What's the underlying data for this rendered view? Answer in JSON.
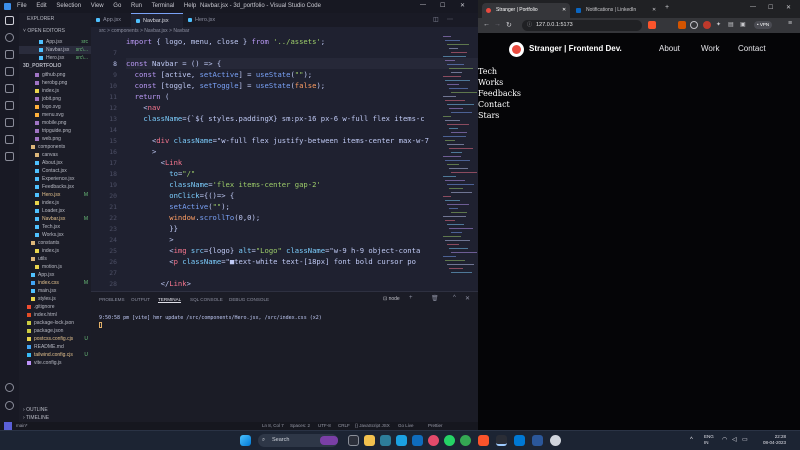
{
  "vscode": {
    "title": "Navbar.jsx - 3d_portfolio - Visual Studio Code",
    "menu": [
      "File",
      "Edit",
      "Selection",
      "View",
      "Go",
      "Run",
      "Terminal",
      "Help"
    ],
    "explorer_title": "EXPLORER",
    "open_editors": "OPEN EDITORS",
    "project": "3D_PORTFOLIO",
    "files": [
      {
        "name": "App.jsx",
        "badge": "src",
        "color": "#4fc1ff",
        "indent": 2
      },
      {
        "name": "Navbar.jsx",
        "badge": "src\\...",
        "color": "#4fc1ff",
        "indent": 2
      },
      {
        "name": "Hero.jsx",
        "badge": "src\\...",
        "color": "#4fc1ff",
        "indent": 2
      },
      {
        "name": "github.png",
        "badge": "",
        "color": "#a074c4",
        "indent": 1
      },
      {
        "name": "herobg.png",
        "badge": "",
        "color": "#a074c4",
        "indent": 1
      },
      {
        "name": "index.js",
        "badge": "",
        "color": "#e8d44d",
        "indent": 1
      },
      {
        "name": "jobit.png",
        "badge": "",
        "color": "#a074c4",
        "indent": 1
      },
      {
        "name": "logo.svg",
        "badge": "",
        "color": "#ffb13b",
        "indent": 1
      },
      {
        "name": "menu.svg",
        "badge": "",
        "color": "#ffb13b",
        "indent": 1
      },
      {
        "name": "mobile.png",
        "badge": "",
        "color": "#a074c4",
        "indent": 1
      },
      {
        "name": "tripguide.png",
        "badge": "",
        "color": "#a074c4",
        "indent": 1
      },
      {
        "name": "web.png",
        "badge": "",
        "color": "#a074c4",
        "indent": 1
      },
      {
        "name": "components",
        "badge": "",
        "color": "#dcb67a",
        "indent": 0
      },
      {
        "name": "canvas",
        "badge": "",
        "color": "#dcb67a",
        "indent": 1
      },
      {
        "name": "About.jsx",
        "badge": "",
        "color": "#4fc1ff",
        "indent": 1
      },
      {
        "name": "Contact.jsx",
        "badge": "",
        "color": "#4fc1ff",
        "indent": 1
      },
      {
        "name": "Experience.jsx",
        "badge": "",
        "color": "#4fc1ff",
        "indent": 1
      },
      {
        "name": "Feedbacks.jsx",
        "badge": "",
        "color": "#4fc1ff",
        "indent": 1
      },
      {
        "name": "Hero.jsx",
        "badge": "M",
        "color": "#4fc1ff",
        "indent": 1
      },
      {
        "name": "index.js",
        "badge": "",
        "color": "#e8d44d",
        "indent": 1
      },
      {
        "name": "Loader.jsx",
        "badge": "",
        "color": "#4fc1ff",
        "indent": 1
      },
      {
        "name": "Navbar.jsx",
        "badge": "M",
        "color": "#4fc1ff",
        "indent": 1
      },
      {
        "name": "Tech.jsx",
        "badge": "",
        "color": "#4fc1ff",
        "indent": 1
      },
      {
        "name": "Works.jsx",
        "badge": "",
        "color": "#4fc1ff",
        "indent": 1
      },
      {
        "name": "constants",
        "badge": "",
        "color": "#dcb67a",
        "indent": 0
      },
      {
        "name": "index.js",
        "badge": "",
        "color": "#e8d44d",
        "indent": 1
      },
      {
        "name": "utils",
        "badge": "",
        "color": "#dcb67a",
        "indent": 0
      },
      {
        "name": "motion.js",
        "badge": "",
        "color": "#e8d44d",
        "indent": 1
      },
      {
        "name": "App.jsx",
        "badge": "",
        "color": "#4fc1ff",
        "indent": 0
      },
      {
        "name": "index.css",
        "badge": "M",
        "color": "#42a5f5",
        "indent": 0
      },
      {
        "name": "main.jsx",
        "badge": "",
        "color": "#4fc1ff",
        "indent": 0
      },
      {
        "name": "styles.js",
        "badge": "",
        "color": "#e8d44d",
        "indent": 0
      },
      {
        "name": ".gitignore",
        "badge": "",
        "color": "#f14e32",
        "indent": -1
      },
      {
        "name": "index.html",
        "badge": "",
        "color": "#e44d26",
        "indent": -1
      },
      {
        "name": "package-lock.json",
        "badge": "",
        "color": "#cbcb41",
        "indent": -1
      },
      {
        "name": "package.json",
        "badge": "",
        "color": "#cbcb41",
        "indent": -1
      },
      {
        "name": "postcss.config.cjs",
        "badge": "U",
        "color": "#e8d44d",
        "indent": -1
      },
      {
        "name": "README.md",
        "badge": "",
        "color": "#42a5f5",
        "indent": -1
      },
      {
        "name": "tailwind.config.cjs",
        "badge": "U",
        "color": "#38bdf8",
        "indent": -1
      },
      {
        "name": "vite.config.js",
        "badge": "",
        "color": "#bd93f9",
        "indent": -1
      }
    ],
    "outline": "OUTLINE",
    "timeline": "TIMELINE",
    "tabs": [
      "App.jsx",
      "Navbar.jsx",
      "Hero.jsx"
    ],
    "active_tab": 1,
    "breadcrumb": "src > components > Navbar.jsx > Navbar",
    "code_lines": [
      {
        "n": "",
        "html": "import { logo, menu, close } from '../assets';"
      },
      {
        "n": "7",
        "html": ""
      },
      {
        "n": "8",
        "html": "const Navbar = () => {"
      },
      {
        "n": "9",
        "html": "  const [active, setActive] = useState(\"\");"
      },
      {
        "n": "10",
        "html": "  const [toggle, setToggle] = useState(false);"
      },
      {
        "n": "11",
        "html": "  return ("
      },
      {
        "n": "12",
        "html": "    <nav"
      },
      {
        "n": "13",
        "html": "    className={`${ styles.paddingX} sm:px-16 px-6 w-full flex items-c"
      },
      {
        "n": "14",
        "html": ""
      },
      {
        "n": "15",
        "html": "      <div className=\"w-full flex justify-between items-center max-w-7"
      },
      {
        "n": "16",
        "html": "      >"
      },
      {
        "n": "17",
        "html": "        <Link"
      },
      {
        "n": "18",
        "html": "          to=\"/\""
      },
      {
        "n": "19",
        "html": "          className='flex items-center gap-2'"
      },
      {
        "n": "20",
        "html": "          onClick={()=> {"
      },
      {
        "n": "21",
        "html": "          setActive(\"\");"
      },
      {
        "n": "22",
        "html": "          window.scrollTo(0,0);"
      },
      {
        "n": "23",
        "html": "          }}"
      },
      {
        "n": "24",
        "html": "          >"
      },
      {
        "n": "25",
        "html": "          <img src={logo} alt=\"Logo\" className=\"w-9 h-9 object-conta"
      },
      {
        "n": "26",
        "html": "          <p className=\"■text-white text-[18px] font bold cursor po"
      },
      {
        "n": "27",
        "html": ""
      },
      {
        "n": "28",
        "html": "        </Link>"
      }
    ],
    "panel_tabs": [
      "PROBLEMS",
      "OUTPUT",
      "TERMINAL",
      "SQL CONSOLE",
      "DEBUG CONSOLE"
    ],
    "active_panel_tab": 2,
    "terminal_label": "node",
    "terminal_line": "9:50:58 pm [vite] hmr update /src/components/Hero.jsx, /src/index.css (x2)",
    "status_left": "main*",
    "status_right": [
      "Ln 8, Col 7",
      "Spaces: 2",
      "UTF-8",
      "CRLF",
      "{} JavaScript JSX",
      "Go Live",
      "Prettier"
    ]
  },
  "browser": {
    "tabs": [
      "Stranger | Portfolio",
      "Notifications | LinkedIn"
    ],
    "url": "127.0.0.1:5173",
    "vpn": "VPN",
    "site": {
      "brand": "Stranger |  Frontend Dev.",
      "nav": [
        "About",
        "Work",
        "Contact"
      ],
      "list": [
        "Tech",
        "Works",
        "Feedbacks",
        "Contact",
        "Stars"
      ]
    }
  },
  "taskbar": {
    "search": "Search",
    "lang": "ENG",
    "region": "IN",
    "time": "22:28",
    "date": "08-04-2023"
  }
}
